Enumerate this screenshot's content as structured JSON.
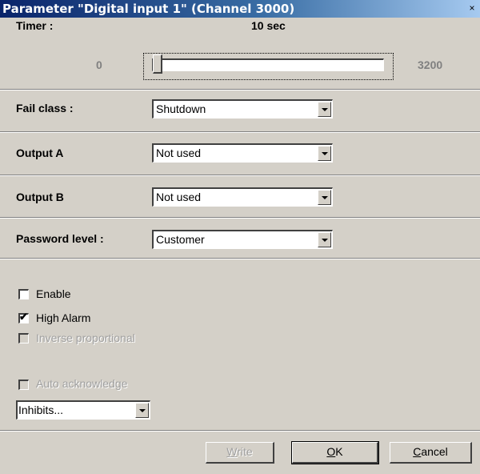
{
  "window": {
    "title": "Parameter \"Digital input 1\" (Channel 3000)",
    "close_glyph": "×"
  },
  "timer": {
    "label": "Timer :",
    "value_text": "10 sec",
    "min": "0",
    "max": "3200",
    "value": 10
  },
  "fail_class": {
    "label": "Fail class :",
    "selected": "Shutdown"
  },
  "output_a": {
    "label": "Output A",
    "selected": "Not used"
  },
  "output_b": {
    "label": "Output B",
    "selected": "Not used"
  },
  "password_level": {
    "label": "Password level :",
    "selected": "Customer"
  },
  "options": {
    "enable": {
      "label": "Enable",
      "checked": false
    },
    "high_alarm": {
      "label": "High Alarm",
      "checked": true,
      "mark": "✔"
    },
    "inverse_proportional": {
      "label": "Inverse proportional",
      "checked": false,
      "disabled": true
    },
    "auto_acknowledge": {
      "label": "Auto acknowledge",
      "checked": false,
      "disabled": true
    }
  },
  "inhibits": {
    "selected": "Inhibits..."
  },
  "buttons": {
    "write": {
      "mnemonic": "W",
      "rest": "rite"
    },
    "ok": {
      "mnemonic": "O",
      "rest": "K"
    },
    "cancel": {
      "mnemonic": "C",
      "rest": "ancel"
    }
  }
}
